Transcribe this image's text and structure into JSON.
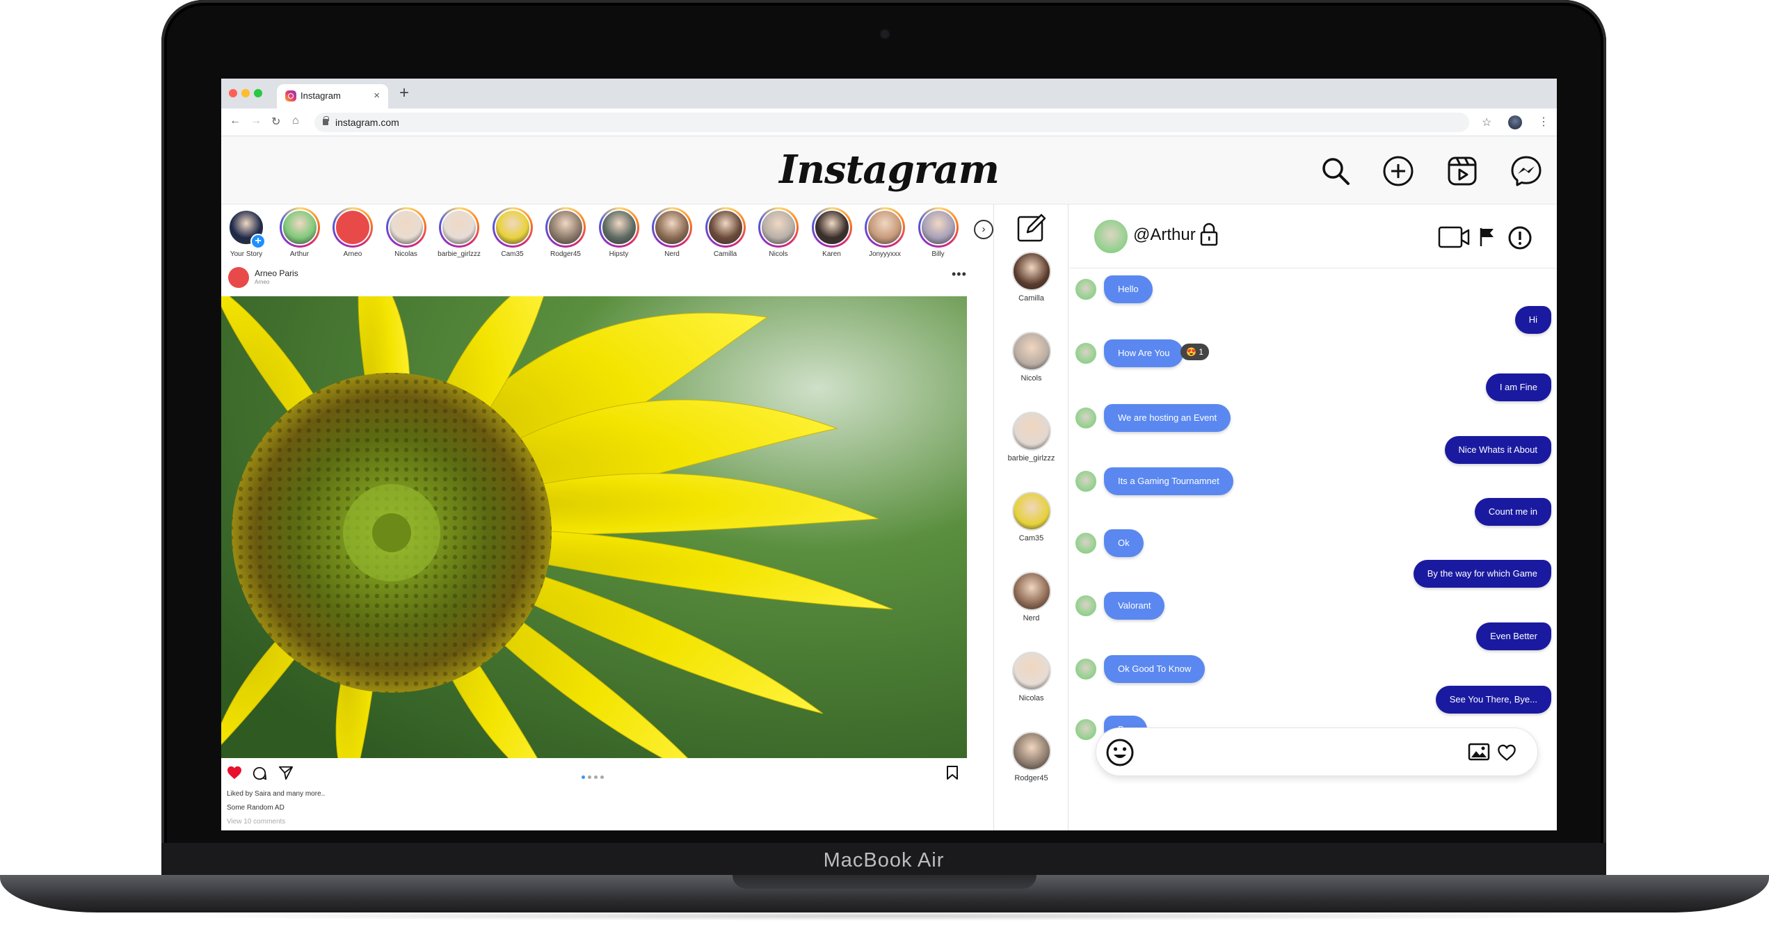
{
  "device": {
    "brand_label": "MacBook Air"
  },
  "browser": {
    "tab_title": "Instagram",
    "tab_close": "×",
    "new_tab": "+",
    "url": "instagram.com",
    "nav": {
      "back": "←",
      "forward": "→",
      "reload": "↻",
      "home": "⌂"
    },
    "star": "☆",
    "menu": "⋮",
    "traffic_colors": [
      "#ff5f57",
      "#febc2e",
      "#28c840"
    ]
  },
  "app": {
    "logo": "Instagram",
    "header_icons": [
      "search-icon",
      "new-post-icon",
      "reels-icon",
      "messenger-icon"
    ]
  },
  "stories": [
    {
      "label": "Your Story",
      "color": "#1f2a4a"
    },
    {
      "label": "Arthur",
      "color": "#7fc97a"
    },
    {
      "label": "Arneo",
      "color": "#e84a4a"
    },
    {
      "label": "Nicolas",
      "color": "#e8dcd2"
    },
    {
      "label": "barbie_girlzzz",
      "color": "#e6ddd6"
    },
    {
      "label": "Cam35",
      "color": "#e8d23a"
    },
    {
      "label": "Rodger45",
      "color": "#8d7a6a"
    },
    {
      "label": "Hipsty",
      "color": "#5e6b63"
    },
    {
      "label": "Nerd",
      "color": "#8a6a52"
    },
    {
      "label": "Camilla",
      "color": "#6b4a3a"
    },
    {
      "label": "Nicols",
      "color": "#b9b0a8"
    },
    {
      "label": "Karen",
      "color": "#3a2e2a"
    },
    {
      "label": "Jonyyyxxx",
      "color": "#c79a7a"
    },
    {
      "label": "Billy",
      "color": "#a8a0b8"
    }
  ],
  "stories_next": "›",
  "post": {
    "author": "Arneo Paris",
    "sub": "Arneo",
    "more": "•••",
    "liked_by": "Liked by Saira and many more..",
    "caption": "Some Random AD",
    "comments": "View 10 comments",
    "carousel_dots": 4,
    "carousel_active": 0
  },
  "contacts": [
    {
      "name": "Camilla",
      "color": "#5a3a2c"
    },
    {
      "name": "Nicols",
      "color": "#b8aca2"
    },
    {
      "name": "barbie_girlzzz",
      "color": "#e2d8d0"
    },
    {
      "name": "Cam35",
      "color": "#e5d13a"
    },
    {
      "name": "Nerd",
      "color": "#8a6650"
    },
    {
      "name": "Nicolas",
      "color": "#e6dcd4"
    },
    {
      "name": "Rodger45",
      "color": "#8a786a"
    }
  ],
  "chat": {
    "handle": "@Arthur",
    "messages": [
      {
        "dir": "in",
        "text": "Hello"
      },
      {
        "dir": "out",
        "text": "Hi"
      },
      {
        "dir": "in",
        "text": "How Are You",
        "reaction": "😍 1"
      },
      {
        "dir": "out",
        "text": "I am Fine"
      },
      {
        "dir": "in",
        "text": "We are hosting an Event"
      },
      {
        "dir": "out",
        "text": "Nice Whats it About"
      },
      {
        "dir": "in",
        "text": "Its a Gaming Tournamnet"
      },
      {
        "dir": "out",
        "text": "Count me in"
      },
      {
        "dir": "in",
        "text": "Ok"
      },
      {
        "dir": "out",
        "text": "By the way for which Game"
      },
      {
        "dir": "in",
        "text": "Valorant"
      },
      {
        "dir": "out",
        "text": "Even Better"
      },
      {
        "dir": "in",
        "text": "Ok Good To Know"
      },
      {
        "dir": "out",
        "text": "See You There, Bye..."
      },
      {
        "dir": "in",
        "text": "Bye"
      }
    ],
    "colors": {
      "incoming": "#5a88f0",
      "outgoing": "#1a1aa0"
    }
  }
}
